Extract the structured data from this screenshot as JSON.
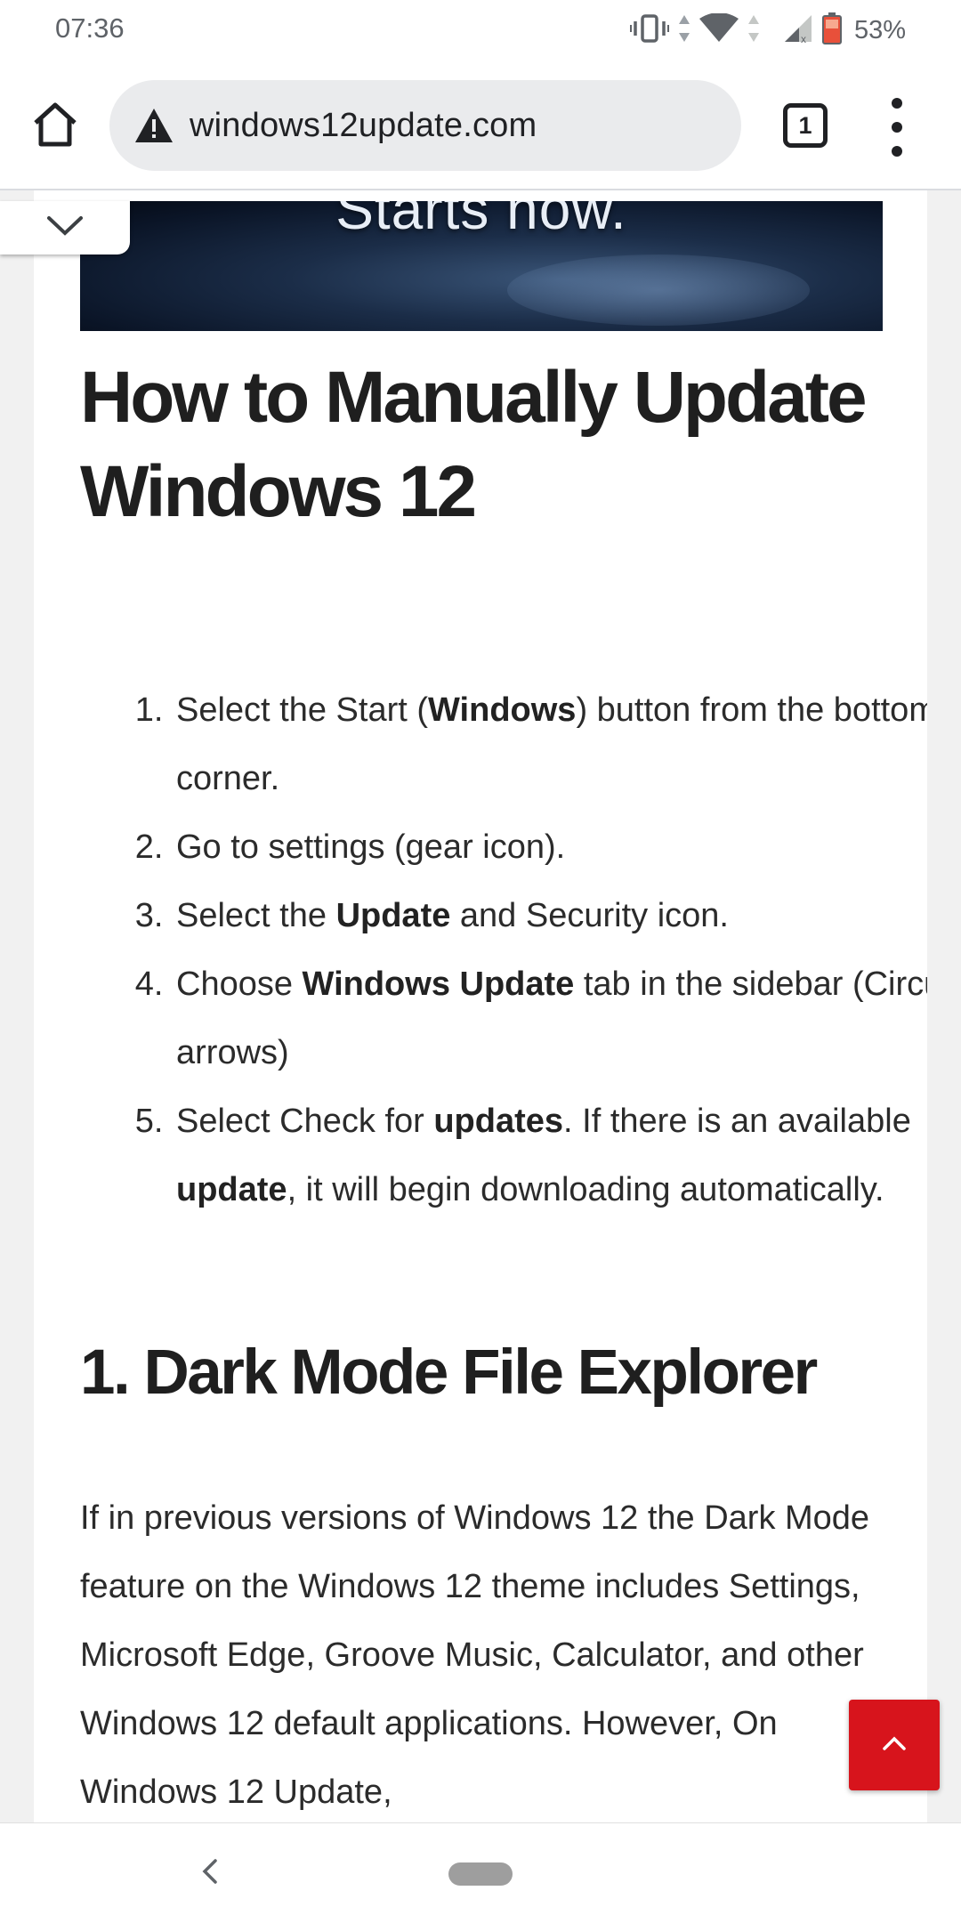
{
  "status_bar": {
    "time": "07:36",
    "battery_percent": "53%",
    "icons": [
      "vibrate-icon",
      "data-arrows-icon",
      "wifi-icon",
      "cell-signal-icon",
      "battery-icon"
    ]
  },
  "browser": {
    "url": "windows12update.com",
    "security_icon": "warning-icon",
    "tab_count": "1"
  },
  "article": {
    "hero_text": "Starts now.",
    "title": "How to Manually Update Windows 12",
    "steps": [
      {
        "pre": "Select the Start (",
        "bold": "Windows",
        "post": ") button from the bottom-left corner."
      },
      {
        "pre": "Go to settings (gear icon).",
        "bold": "",
        "post": ""
      },
      {
        "pre": "Select the ",
        "bold": "Update",
        "post": " and Security icon."
      },
      {
        "pre": "Choose ",
        "bold": "Windows Update",
        "post": " tab in the sidebar (Circular arrows)"
      },
      {
        "pre": "Select Check for ",
        "bold": "updates",
        "post": ". If there is an available ",
        "bold2": "update",
        "post2": ", it will begin downloading automatically."
      }
    ],
    "section_heading": "1. Dark Mode File Explorer",
    "paragraph": "If in previous versions of Windows 12 the Dark Mode feature on the Windows 12 theme includes Settings, Microsoft Edge, Groove Music, Calculator, and other Windows 12 default applications. However, On Windows 12 Update,"
  },
  "colors": {
    "scroll_top_button": "#d7141c",
    "page_background": "#ffffff",
    "gutter": "#f1f1f1"
  }
}
